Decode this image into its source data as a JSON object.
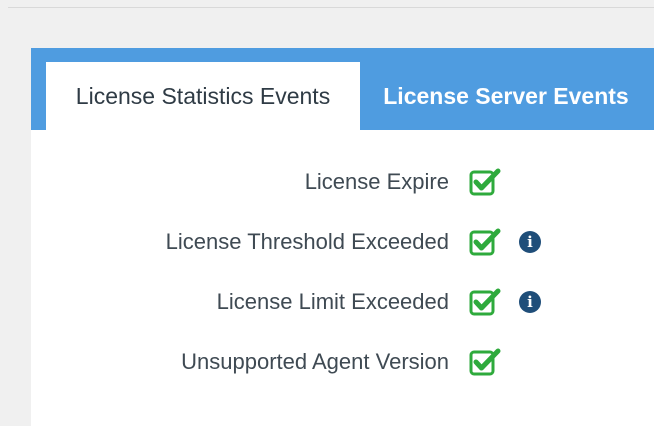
{
  "tabs": {
    "active_label": "License Statistics Events",
    "inactive_label": "License Server Events"
  },
  "events": [
    {
      "label": "License Expire",
      "checked": true,
      "info": false
    },
    {
      "label": "License Threshold Exceeded",
      "checked": true,
      "info": true
    },
    {
      "label": "License Limit Exceeded",
      "checked": true,
      "info": true
    },
    {
      "label": "Unsupported Agent Version",
      "checked": true,
      "info": false
    }
  ],
  "icons": {
    "checkbox": "checked-square-icon",
    "info": "info-circle-icon",
    "info_glyph": "i"
  },
  "colors": {
    "tab_bar": "#4f9ce0",
    "check_green": "#2eaa3c",
    "info_navy": "#1f4e79"
  }
}
